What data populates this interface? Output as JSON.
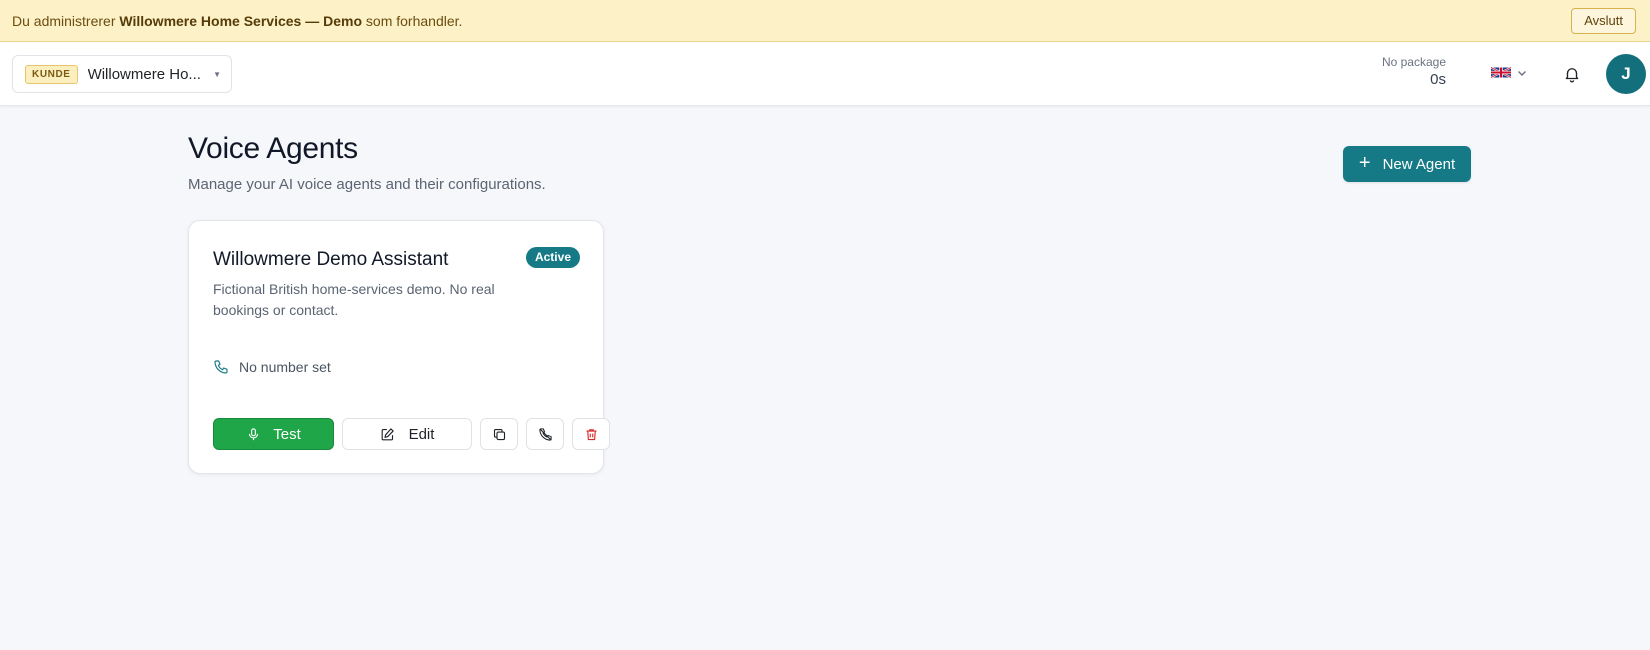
{
  "banner": {
    "prefix": "Du administrerer",
    "tenant": "Willowmere Home Services — Demo",
    "suffix": "som forhandler.",
    "exit_label": "Avslutt"
  },
  "topbar": {
    "tenant_badge": "KUNDE",
    "tenant_name": "Willowmere Ho...",
    "package_label": "No package",
    "package_value": "0s",
    "language_icon": "uk-flag-icon",
    "avatar_initial": "J"
  },
  "page": {
    "title": "Voice Agents",
    "subtitle": "Manage your AI voice agents and their configurations.",
    "new_agent_label": "New Agent"
  },
  "agents": [
    {
      "name": "Willowmere Demo Assistant",
      "status": "Active",
      "description": "Fictional British home-services demo. No real bookings or contact.",
      "phone": "No number set",
      "test_label": "Test",
      "edit_label": "Edit"
    }
  ],
  "colors": {
    "accent": "#167a86",
    "test_green": "#1fa648",
    "banner_bg": "#fdf1c7",
    "delete_red": "#dc2626"
  }
}
